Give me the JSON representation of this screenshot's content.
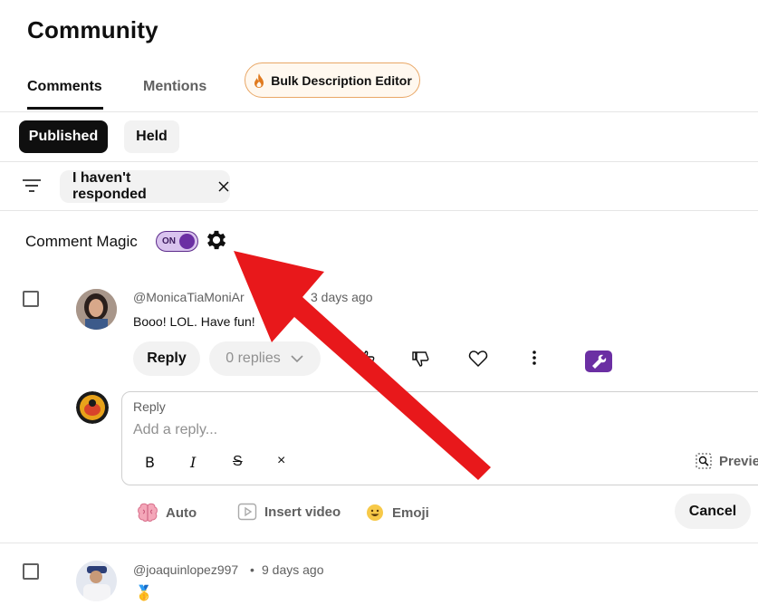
{
  "header": {
    "title": "Community"
  },
  "tabs": [
    {
      "label": "Comments",
      "active": true
    },
    {
      "label": "Mentions",
      "active": false
    }
  ],
  "bulk_editor": {
    "label": "Bulk Description Editor",
    "icon": "flame-icon",
    "accent": "#e9a766"
  },
  "filters": {
    "published": "Published",
    "held": "Held",
    "active_filter": "I haven't responded"
  },
  "comment_magic": {
    "label": "Comment Magic",
    "toggle": "ON"
  },
  "comments": [
    {
      "author": "@MonicaTiaMoniAr",
      "time": "3 days ago",
      "text": "Booo!  LOL.  Have fun!",
      "reply_label": "Reply",
      "replies_label": "0 replies"
    },
    {
      "author": "@joaquinlopez997",
      "time": "9 days ago",
      "text": "🥇"
    }
  ],
  "reply_box": {
    "label": "Reply",
    "placeholder": "Add a reply...",
    "format": {
      "bold": "B",
      "italic": "I",
      "strike": "S",
      "clear": "×"
    },
    "preview": "Previe"
  },
  "tools": {
    "auto": "Auto",
    "video": "Insert video",
    "emoji": "Emoji",
    "cancel": "Cancel"
  },
  "separator": "•",
  "colors": {
    "accent_purple": "#6b2fa3",
    "arrow_red": "#e8181b"
  }
}
